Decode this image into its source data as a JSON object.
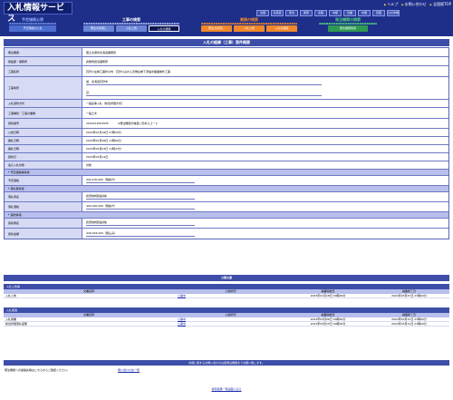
{
  "header": {
    "logo": "入札情報サービス",
    "toplinks": [
      "ヘルプ",
      "お問い合わせ",
      "全国版TOP"
    ],
    "regions": [
      "全国",
      "北海道",
      "東北",
      "関東",
      "北陸",
      "中部",
      "近畿",
      "中国",
      "四国",
      "九州沖縄"
    ],
    "groups": [
      {
        "caption": "予定価格公表",
        "tabs": [
          "予定価格の公表"
        ],
        "color": "#4c6ed0"
      },
      {
        "caption": "工事の検索",
        "tabs": [
          "発注の見通し",
          "入札公告",
          "入札の経緯"
        ],
        "color": "#6a85d8"
      },
      {
        "caption": "業務の検索",
        "tabs": [
          "発注の見通し",
          "入札公告",
          "入札の経緯"
        ],
        "color": "#f0872a"
      },
      {
        "caption": "発注機関の検索",
        "tabs": [
          "発注機関情報"
        ],
        "color": "#2f9a52"
      }
    ]
  },
  "detail": {
    "title": "入札の経緯（工事）案件概要",
    "rows": [
      {
        "label": "発注機関",
        "value": "国土交通省北海道開発局"
      },
      {
        "label": "施設部・事務所",
        "value": "倉敷局担当事務所"
      },
      {
        "label": "工事名称",
        "value": "石狩川左岸工事外の内　石狩川みかん天端左岸下流堤水路護岸外工事"
      },
      {
        "label": "工事場所",
        "value": "旭：北海道石狩市",
        "value2": "旦："
      },
      {
        "label": "入札契約方式",
        "value": "一般競争入札（総合評価方式）"
      },
      {
        "label": "工事種別／工事の業種",
        "value": "一般土木"
      },
      {
        "label": "契約番号",
        "value": "2022212003935",
        "note": "※発注機関が独自に定めるコード"
      },
      {
        "label": "公告日時",
        "value": "2023年01月18日 07時30分"
      },
      {
        "label": "開札日時",
        "value": "2023年01月26日 11時00分"
      },
      {
        "label": "開札日時",
        "value": "2023年03月03日 11時43分"
      },
      {
        "label": "契約日",
        "value": "2023年03月14日"
      },
      {
        "label": "電子入札対象",
        "value": "対象"
      }
    ],
    "price_section": "予定価格等情報",
    "price_rows": [
      {
        "label": "予定価格",
        "value": "442,230,000（税抜き）"
      }
    ],
    "winner_section": "落札者情報",
    "winner_rows": [
      {
        "label": "落札者名",
        "value": "倉田地崎建設(株)"
      },
      {
        "label": "落札価格",
        "value": "400,040,000（税抜き）"
      }
    ],
    "contract_section": "契約情報",
    "contract_rows": [
      {
        "label": "契約者名",
        "value": "倉田地崎建設(株)"
      },
      {
        "label": "契約金額",
        "value": "440,044,000（税込み）"
      }
    ]
  },
  "docs": {
    "title": "公開文書",
    "groups": [
      {
        "name": "入札公告等",
        "headers": [
          "文書名称",
          "公開状況",
          "掲載開始日",
          "掲載終了日"
        ],
        "rows": [
          {
            "name": "入札公告",
            "status": "公開中",
            "start": "2023年01月18日 00時00分",
            "end": "2024年03月31日 23時00分"
          }
        ]
      },
      {
        "name": "入札経過",
        "headers": [
          "文書名称",
          "公開状況",
          "掲載開始日",
          "掲載終了日"
        ],
        "rows": [
          {
            "name": "入札調書",
            "status": "公開中",
            "start": "2023年03月06日 00時00分",
            "end": "2024年03月31日 23時00分"
          },
          {
            "name": "総合評価落札結果",
            "status": "公開中",
            "start": "2023年03月15日 00時00分",
            "end": "2024年03月31日 23時00分"
          }
        ]
      }
    ]
  },
  "contact": {
    "bar": "内容に関するお問い合わせは各発注機関までお願い致します。",
    "text": "発注機関への連絡先等はこちらからご確認ください。",
    "link": "問い合わせ先一覧"
  },
  "back": "検索結果一覧画面に戻る"
}
